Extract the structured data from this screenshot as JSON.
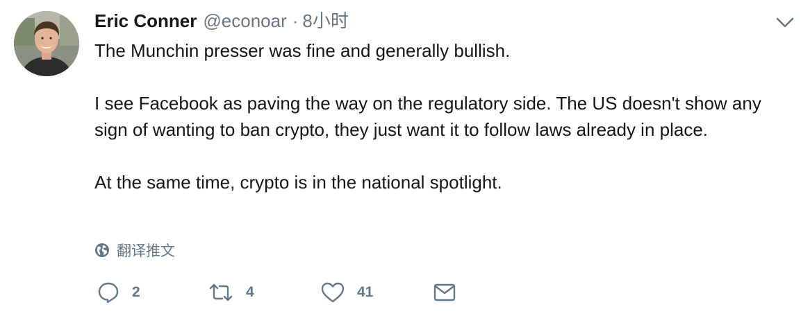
{
  "tweet": {
    "author_name": "Eric Conner",
    "author_handle": "@econoar",
    "separator": "·",
    "time": "8小时",
    "paragraphs": [
      "The Munchin presser was fine and generally bullish.",
      "I see Facebook as paving the way on the regulatory side. The US doesn't show any sign of wanting to ban crypto, they just want it to follow laws already in place.",
      "At the same time, crypto is in the national spotlight."
    ],
    "translate_label": "翻译推文"
  },
  "actions": {
    "reply_count": "2",
    "retweet_count": "4",
    "like_count": "41"
  },
  "colors": {
    "text": "#14171a",
    "secondary": "#657786"
  },
  "icons": {
    "avatar": "profile-photo",
    "caret": "chevron-down-icon",
    "translate": "globe-icon",
    "reply": "reply-icon",
    "retweet": "retweet-icon",
    "like": "heart-icon",
    "message": "envelope-icon"
  }
}
